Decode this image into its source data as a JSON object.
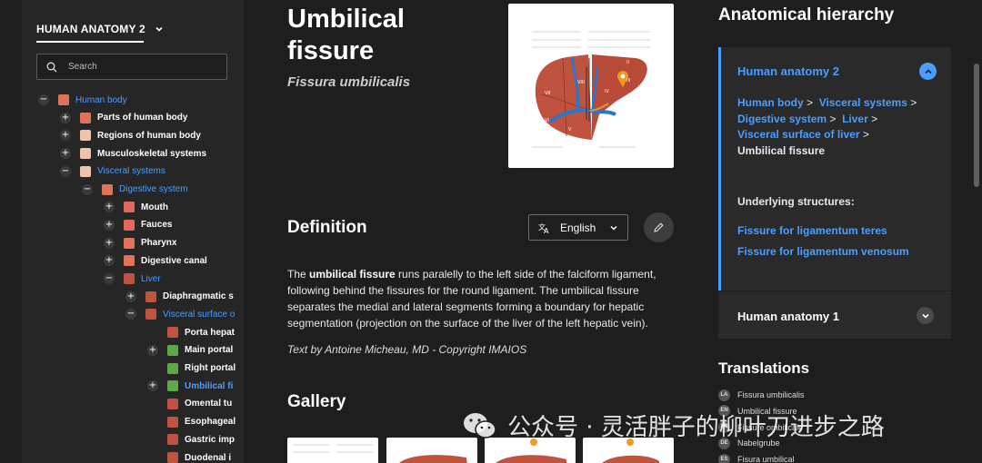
{
  "sidebar": {
    "header": "HUMAN ANATOMY 2",
    "search_placeholder": "Search",
    "items": [
      {
        "label": "Human body",
        "toggle": "−",
        "state": "active"
      },
      {
        "label": "Parts of human body",
        "toggle": "+",
        "state": "normal"
      },
      {
        "label": "Regions of human body",
        "toggle": "+",
        "state": "normal"
      },
      {
        "label": "Musculoskeletal systems",
        "toggle": "+",
        "state": "normal"
      },
      {
        "label": "Visceral systems",
        "toggle": "−",
        "state": "active"
      },
      {
        "label": "Digestive system",
        "toggle": "−",
        "state": "active"
      },
      {
        "label": "Mouth",
        "toggle": "+",
        "state": "normal"
      },
      {
        "label": "Fauces",
        "toggle": "+",
        "state": "normal"
      },
      {
        "label": "Pharynx",
        "toggle": "+",
        "state": "normal"
      },
      {
        "label": "Digestive canal",
        "toggle": "+",
        "state": "normal"
      },
      {
        "label": "Liver",
        "toggle": "−",
        "state": "active"
      },
      {
        "label": "Diaphragmatic s",
        "toggle": "+",
        "state": "normal"
      },
      {
        "label": "Visceral surface o",
        "toggle": "−",
        "state": "active"
      },
      {
        "label": "Porta hepat",
        "toggle": "",
        "state": "normal"
      },
      {
        "label": "Main portal",
        "toggle": "+",
        "state": "normal"
      },
      {
        "label": "Right portal",
        "toggle": "",
        "state": "normal"
      },
      {
        "label": "Umbilical fi",
        "toggle": "+",
        "state": "selected"
      },
      {
        "label": "Omental tu",
        "toggle": "",
        "state": "normal"
      },
      {
        "label": "Esophageal",
        "toggle": "",
        "state": "normal"
      },
      {
        "label": "Gastric imp",
        "toggle": "",
        "state": "normal"
      },
      {
        "label": "Duodenal i",
        "toggle": "",
        "state": "normal"
      }
    ]
  },
  "main": {
    "title": "Umbilical fissure",
    "latin": "Fissura umbilicalis",
    "definition_heading": "Definition",
    "language": "English",
    "definition_pre": "The ",
    "definition_bold": "umbilical fissure",
    "definition_post": " runs paralelly to the left side of the falciform ligament, following behind the fissures for the round ligament. The umbilical fissure separates the medial and lateral segments forming a boundary for hepatic segmentation (projection on the surface of the liver of the left hepatic vein).",
    "credit": "Text by Antoine Micheau, MD - Copyright IMAIOS",
    "gallery_heading": "Gallery"
  },
  "right": {
    "title": "Anatomical hierarchy",
    "card1_title": "Human anatomy 2",
    "crumbs": [
      "Human body",
      "Visceral systems",
      "Digestive system",
      "Liver",
      "Visceral surface of liver"
    ],
    "current": "Umbilical fissure",
    "underlying_label": "Underlying structures:",
    "underlying": [
      "Fissure for ligamentum teres",
      "Fissure for ligamentum venosum"
    ],
    "card2_title": "Human anatomy 1",
    "translations_title": "Translations",
    "translations": [
      {
        "code": "LA",
        "text": "Fissura umbilicalis"
      },
      {
        "code": "EN",
        "text": "Umbilical fissure"
      },
      {
        "code": "FR",
        "text": "Fissure ombilicale"
      },
      {
        "code": "DE",
        "text": "Nabelgrube"
      },
      {
        "code": "ES",
        "text": "Fisura umbilical"
      }
    ]
  },
  "watermark": "公众号 · 灵活胖子的柳叶刀进步之路",
  "colors": {
    "accent": "#4a9eff",
    "background": "#1e1e1e",
    "panel": "#2a2a2a",
    "organ": "#c0533f"
  }
}
